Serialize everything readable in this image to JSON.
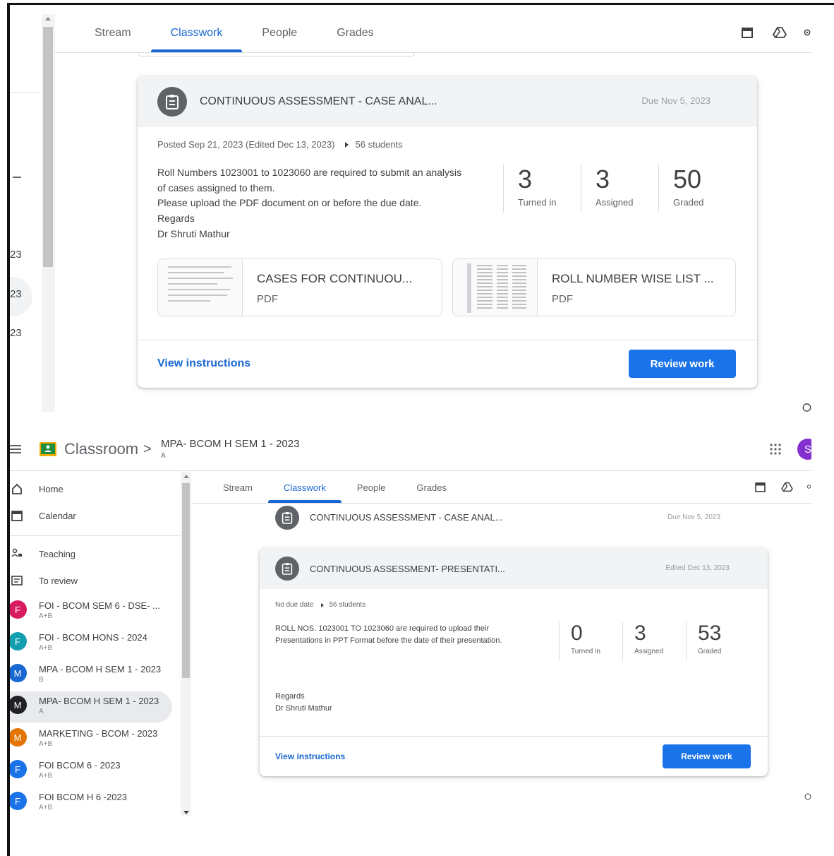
{
  "top_section": {
    "tabs": [
      {
        "label": "Stream"
      },
      {
        "label": "Classwork"
      },
      {
        "label": "People"
      },
      {
        "label": "Grades"
      }
    ],
    "left_partial_labels": [
      "23",
      "23",
      "23"
    ],
    "card": {
      "title": "CONTINUOUS ASSESSMENT - CASE ANAL...",
      "due": "Due Nov 5, 2023",
      "posted": "Posted Sep 21, 2023 (Edited Dec 13, 2023)",
      "students": "56 students",
      "description": [
        "Roll Numbers 1023001 to 1023060 are required to submit an analysis",
        "of cases assigned to them.",
        "Please upload the PDF document on or before the due date.",
        "Regards",
        "Dr Shruti Mathur"
      ],
      "stats": [
        {
          "value": "3",
          "label": "Turned in"
        },
        {
          "value": "3",
          "label": "Assigned"
        },
        {
          "value": "50",
          "label": "Graded"
        }
      ],
      "attachments": [
        {
          "title": "CASES FOR CONTINUOU...",
          "type": "PDF"
        },
        {
          "title": "ROLL NUMBER WISE LIST ...",
          "type": "PDF"
        }
      ],
      "view_instructions": "View instructions",
      "review_work": "Review work"
    }
  },
  "bottom_section": {
    "app_name": "Classroom",
    "breadcrumb_separator": ">",
    "class_title": "MPA- BCOM H SEM 1 - 2023",
    "class_section": "A",
    "avatar_letter": "S",
    "sidebar": {
      "nav": [
        {
          "label": "Home"
        },
        {
          "label": "Calendar"
        },
        {
          "label": "Teaching"
        },
        {
          "label": "To review"
        }
      ],
      "classes": [
        {
          "letter": "F",
          "name": "FOI - BCOM SEM 6 - DSE- ...",
          "sub": "A+B",
          "color": "#d81b60"
        },
        {
          "letter": "F",
          "name": "FOI - BCOM HONS - 2024",
          "sub": "A+B",
          "color": "#129eaf"
        },
        {
          "letter": "M",
          "name": "MPA - BCOM H SEM 1 - 2023",
          "sub": "B",
          "color": "#1967d2"
        },
        {
          "letter": "M",
          "name": "MPA- BCOM H SEM 1 - 2023",
          "sub": "A",
          "color": "#202124"
        },
        {
          "letter": "M",
          "name": "MARKETING - BCOM - 2023",
          "sub": "A+B",
          "color": "#e37400"
        },
        {
          "letter": "F",
          "name": "FOI BCOM 6 - 2023",
          "sub": "A+B",
          "color": "#1a73e8"
        },
        {
          "letter": "F",
          "name": "FOI BCOM H 6 -2023",
          "sub": "A+B",
          "color": "#1a73e8"
        }
      ]
    },
    "tabs": [
      {
        "label": "Stream"
      },
      {
        "label": "Classwork"
      },
      {
        "label": "People"
      },
      {
        "label": "Grades"
      }
    ],
    "prev_item": {
      "title": "CONTINUOUS ASSESSMENT - CASE ANAL...",
      "due": "Due Nov 5, 2023"
    },
    "card": {
      "title": "CONTINUOUS ASSESSMENT- PRESENTATI...",
      "edited": "Edited Dec 13, 2023",
      "due_info": "No due date",
      "students": "56 students",
      "description": [
        "ROLL NOS. 1023001 TO  1023060 are required to upload their",
        "Presentations in PPT Format before the date of their presentation."
      ],
      "regards": [
        "Regards",
        "Dr Shruti Mathur"
      ],
      "stats": [
        {
          "value": "0",
          "label": "Turned in"
        },
        {
          "value": "3",
          "label": "Assigned"
        },
        {
          "value": "53",
          "label": "Graded"
        }
      ],
      "view_instructions": "View instructions",
      "review_work": "Review work"
    }
  }
}
